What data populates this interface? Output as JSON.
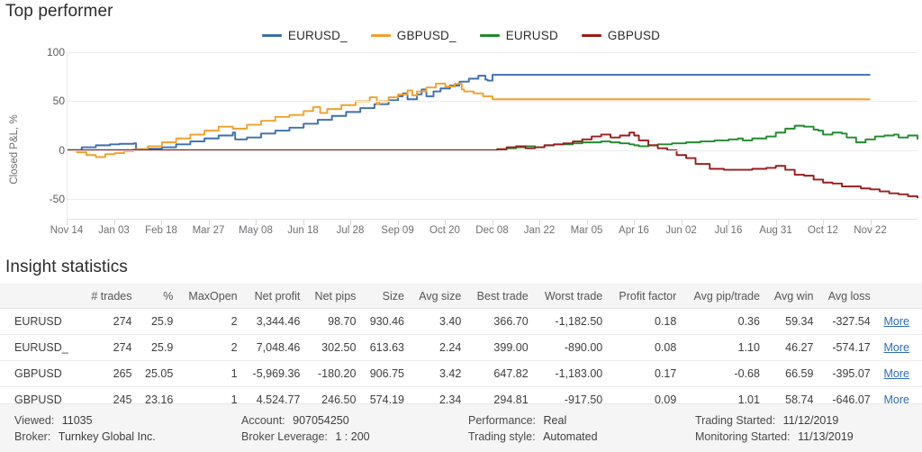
{
  "top_performer": {
    "title": "Top performer"
  },
  "legend": [
    {
      "label": "EURUSD_",
      "color": "#3b6fb0"
    },
    {
      "label": "GBPUSD_",
      "color": "#f0a02a"
    },
    {
      "label": "EURUSD",
      "color": "#1f8b2c"
    },
    {
      "label": "GBPUSD",
      "color": "#9b1c1c"
    }
  ],
  "chart_data": {
    "type": "line",
    "title": "Top performer",
    "xlabel": "",
    "ylabel": "Closed P&L, %",
    "ylim": [
      -70,
      100
    ],
    "yticks": [
      100,
      50,
      0,
      -50
    ],
    "ytick_labels": [
      "100",
      "50",
      "0",
      "-50"
    ],
    "grid": true,
    "legend_position": "top-center",
    "xtick_labels": [
      "Nov 14",
      "Jan 03",
      "Feb 18",
      "Mar 27",
      "May 08",
      "Jun 18",
      "Jul 28",
      "Sep 09",
      "Oct 20",
      "Dec 08",
      "Jan 22",
      "Mar 05",
      "Apr 16",
      "Jun 02",
      "Jul 16",
      "Aug 31",
      "Oct 12",
      "Nov 22"
    ],
    "x_index": [
      0,
      1,
      2,
      3,
      4,
      5,
      6,
      7,
      8,
      9,
      10,
      11,
      12,
      13,
      14,
      15,
      16,
      17
    ],
    "series": [
      {
        "name": "EURUSD_",
        "color": "#3b6fb0",
        "final_value": 77,
        "x": [
          0,
          0.3,
          0.6,
          0.9,
          1.1,
          1.4,
          1.45,
          1.7,
          2.0,
          2.3,
          2.6,
          2.9,
          3.2,
          3.5,
          3.55,
          3.8,
          4.1,
          4.4,
          4.7,
          5.0,
          5.3,
          5.6,
          5.9,
          6.2,
          6.5,
          6.8,
          7.0,
          7.1,
          7.2,
          7.4,
          7.5,
          7.6,
          7.75,
          7.9,
          8.1,
          8.3,
          8.5,
          8.7,
          8.85,
          8.9,
          9.0,
          9.1,
          17
        ],
        "y": [
          0,
          3,
          5,
          6,
          6.5,
          7,
          1,
          1.5,
          3,
          6,
          9,
          12,
          15,
          18,
          11,
          13,
          17,
          20,
          23,
          27,
          31,
          35,
          39,
          43,
          47,
          51,
          55,
          58,
          52,
          57,
          62,
          55,
          60,
          63,
          66,
          70,
          73,
          76,
          72,
          71,
          77,
          77,
          77
        ]
      },
      {
        "name": "GBPUSD_",
        "color": "#f0a02a",
        "final_value": 52,
        "x": [
          0,
          0.2,
          0.4,
          0.6,
          0.8,
          1.0,
          1.2,
          1.4,
          1.7,
          2.0,
          2.3,
          2.6,
          2.9,
          3.2,
          3.5,
          3.8,
          4.1,
          4.4,
          4.7,
          5.0,
          5.2,
          5.35,
          5.5,
          5.8,
          6.1,
          6.4,
          6.55,
          6.6,
          6.8,
          7.0,
          7.2,
          7.3,
          7.4,
          7.6,
          7.8,
          8.0,
          8.2,
          8.35,
          8.4,
          8.6,
          8.8,
          9.0,
          9.05,
          17
        ],
        "y": [
          0,
          -2,
          -5,
          -7,
          -4,
          -3,
          -1,
          1,
          4,
          8,
          12,
          16,
          20,
          24,
          22,
          26,
          30,
          34,
          36,
          40,
          44,
          38,
          42,
          46,
          50,
          54,
          47,
          50,
          54,
          57,
          61,
          56,
          60,
          64,
          68,
          65,
          68,
          62,
          60,
          58,
          55,
          52,
          52,
          52
        ]
      },
      {
        "name": "EURUSD",
        "color": "#1f8b2c",
        "final_value": 11,
        "x": [
          0,
          9.0,
          9.1,
          9.3,
          9.5,
          9.7,
          9.9,
          10.1,
          10.3,
          10.5,
          10.7,
          10.9,
          11.1,
          11.3,
          11.5,
          11.7,
          11.9,
          12.0,
          12.1,
          12.3,
          12.5,
          12.8,
          13.1,
          13.4,
          13.7,
          14.0,
          14.2,
          14.3,
          14.5,
          14.8,
          15.0,
          15.2,
          15.4,
          15.6,
          15.8,
          15.9,
          16.0,
          16.2,
          16.4,
          16.5,
          16.7,
          16.9,
          17.1,
          17.3,
          17.5,
          17.6,
          17.8,
          18
        ],
        "y": [
          0,
          0,
          1,
          2,
          3,
          4,
          3,
          5,
          6,
          6,
          7,
          8,
          8,
          9,
          8,
          7,
          6,
          5,
          4,
          5,
          6,
          7,
          8,
          9,
          10,
          11,
          12,
          10,
          12,
          14,
          18,
          22,
          25,
          24,
          21,
          20,
          16,
          18,
          17,
          13,
          8,
          11,
          14,
          15,
          16,
          13,
          15,
          11
        ]
      },
      {
        "name": "GBPUSD",
        "color": "#9b1c1c",
        "final_value": -49,
        "x": [
          0,
          9.0,
          9.1,
          9.3,
          9.5,
          9.7,
          9.9,
          10.1,
          10.3,
          10.5,
          10.7,
          10.9,
          11.1,
          11.3,
          11.5,
          11.7,
          11.9,
          12.0,
          12.1,
          12.3,
          12.5,
          12.7,
          12.9,
          13.1,
          13.3,
          13.6,
          13.9,
          14.2,
          14.5,
          14.8,
          15.0,
          15.2,
          15.4,
          15.6,
          15.8,
          16.0,
          16.2,
          16.4,
          16.6,
          16.8,
          17.0,
          17.2,
          17.4,
          17.6,
          17.8,
          18
        ],
        "y": [
          0,
          0,
          1,
          3,
          4,
          2,
          3,
          5,
          6,
          7,
          9,
          11,
          14,
          16,
          13,
          15,
          18,
          15,
          10,
          5,
          2,
          0,
          -5,
          -8,
          -14,
          -19,
          -20,
          -20,
          -19,
          -18,
          -16,
          -20,
          -25,
          -26,
          -30,
          -33,
          -34,
          -37,
          -37,
          -39,
          -40,
          -42,
          -44,
          -45,
          -47,
          -49
        ]
      }
    ]
  },
  "insight": {
    "title": "Insight statistics",
    "columns": [
      "",
      "# trades",
      "%",
      "MaxOpen",
      "Net profit",
      "Net pips",
      "Size",
      "Avg size",
      "Best trade",
      "Worst trade",
      "Profit factor",
      "Avg pip/trade",
      "Avg win",
      "Avg loss",
      ""
    ],
    "rows": [
      {
        "symbol": "EURUSD",
        "trades": "274",
        "pct": "25.9",
        "max_open": "2",
        "net_profit": "3,344.46",
        "net_pips": "98.70",
        "size": "930.46",
        "avg_size": "3.40",
        "best_trade": "366.70",
        "worst_trade": "-1,182.50",
        "profit_factor": "0.18",
        "avg_pip_trade": "0.36",
        "avg_win": "59.34",
        "avg_loss": "-327.54",
        "more": "More"
      },
      {
        "symbol": "EURUSD_",
        "trades": "274",
        "pct": "25.9",
        "max_open": "2",
        "net_profit": "7,048.46",
        "net_pips": "302.50",
        "size": "613.63",
        "avg_size": "2.24",
        "best_trade": "399.00",
        "worst_trade": "-890.00",
        "profit_factor": "0.08",
        "avg_pip_trade": "1.10",
        "avg_win": "46.27",
        "avg_loss": "-574.17",
        "more": "More"
      },
      {
        "symbol": "GBPUSD",
        "trades": "265",
        "pct": "25.05",
        "max_open": "1",
        "net_profit": "-5,969.36",
        "net_pips": "-180.20",
        "size": "906.75",
        "avg_size": "3.42",
        "best_trade": "647.82",
        "worst_trade": "-1,183.00",
        "profit_factor": "0.17",
        "avg_pip_trade": "-0.68",
        "avg_win": "66.59",
        "avg_loss": "-395.07",
        "more": "More"
      },
      {
        "symbol": "GBPUSD_",
        "trades": "245",
        "pct": "23.16",
        "max_open": "1",
        "net_profit": "4,524.77",
        "net_pips": "246.50",
        "size": "574.19",
        "avg_size": "2.34",
        "best_trade": "294.81",
        "worst_trade": "-917.50",
        "profit_factor": "0.09",
        "avg_pip_trade": "1.01",
        "avg_win": "58.74",
        "avg_loss": "-646.07",
        "more": "More"
      }
    ]
  },
  "footer": {
    "viewed_label": "Viewed:",
    "viewed_value": "11035",
    "broker_label": "Broker:",
    "broker_value": "Turnkey Global Inc.",
    "account_label": "Account:",
    "account_value": "907054250",
    "leverage_label": "Broker Leverage:",
    "leverage_value": "1 : 200",
    "performance_label": "Performance:",
    "performance_value": "Real",
    "style_label": "Trading style:",
    "style_value": "Automated",
    "trading_started_label": "Trading Started:",
    "trading_started_value": "11/12/2019",
    "monitoring_started_label": "Monitoring Started:",
    "monitoring_started_value": "11/13/2019"
  }
}
